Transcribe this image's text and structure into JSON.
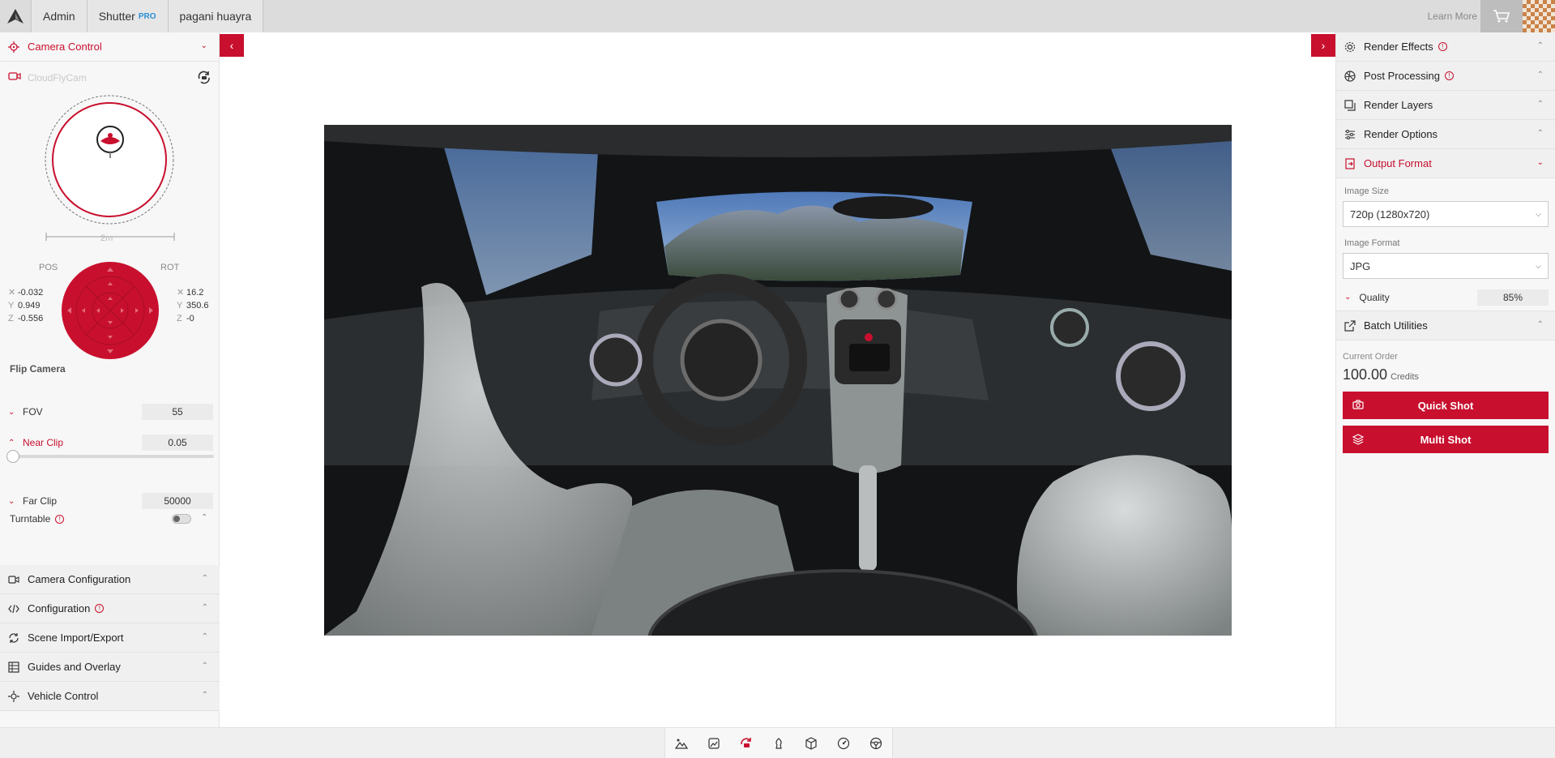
{
  "topbar": {
    "tabs": [
      {
        "label": "Admin"
      },
      {
        "label": "Shutter",
        "badge": "PRO"
      },
      {
        "label": "pagani huayra"
      }
    ],
    "learn_more": "Learn More"
  },
  "left": {
    "header": "Camera Control",
    "camera_name": "CloudFlyCam",
    "scale_label": "2m",
    "pos_label": "POS",
    "rot_label": "ROT",
    "pos": {
      "x": "-0.032",
      "y": "0.949",
      "z": "-0.556"
    },
    "rot": {
      "x": "16.2",
      "y": "350.6",
      "z": "-0"
    },
    "flip_camera": "Flip Camera",
    "fov": {
      "label": "FOV",
      "value": "55"
    },
    "near_clip": {
      "label": "Near Clip",
      "value": "0.05",
      "slider_level": 0.0
    },
    "far_clip": {
      "label": "Far Clip",
      "value": "50000"
    },
    "turntable": {
      "label": "Turntable",
      "enabled": false
    },
    "sections": [
      {
        "label": "Camera Configuration",
        "icon": "camera-icon"
      },
      {
        "label": "Configuration",
        "icon": "code-icon"
      },
      {
        "label": "Scene Import/Export",
        "icon": "sync-icon"
      },
      {
        "label": "Guides and Overlay",
        "icon": "guides-icon"
      },
      {
        "label": "Vehicle Control",
        "icon": "vehicle-icon"
      }
    ]
  },
  "right": {
    "sections": [
      {
        "label": "Render Effects",
        "icon": "gear-icon"
      },
      {
        "label": "Post Processing",
        "icon": "aperture-icon"
      },
      {
        "label": "Render Layers",
        "icon": "layers-icon"
      },
      {
        "label": "Render Options",
        "icon": "sliders-icon"
      }
    ],
    "output_format": {
      "header": "Output Format",
      "image_size_label": "Image Size",
      "image_size_value": "720p (1280x720)",
      "image_format_label": "Image Format",
      "image_format_value": "JPG",
      "quality_label": "Quality",
      "quality_value": "85%"
    },
    "batch_utilities": "Batch Utilities",
    "current_order_label": "Current Order",
    "current_order_value": "100.00",
    "credits_label": "Credits",
    "quick_shot": "Quick Shot",
    "multi_shot": "Multi Shot"
  },
  "bottom_tools": [
    "terrain-icon",
    "image-icon",
    "orbit-camera-icon",
    "chess-icon",
    "cube-icon",
    "speedometer-icon",
    "steering-wheel-icon"
  ],
  "colors": {
    "accent": "#c8102e",
    "pro": "#2a8fd6"
  }
}
